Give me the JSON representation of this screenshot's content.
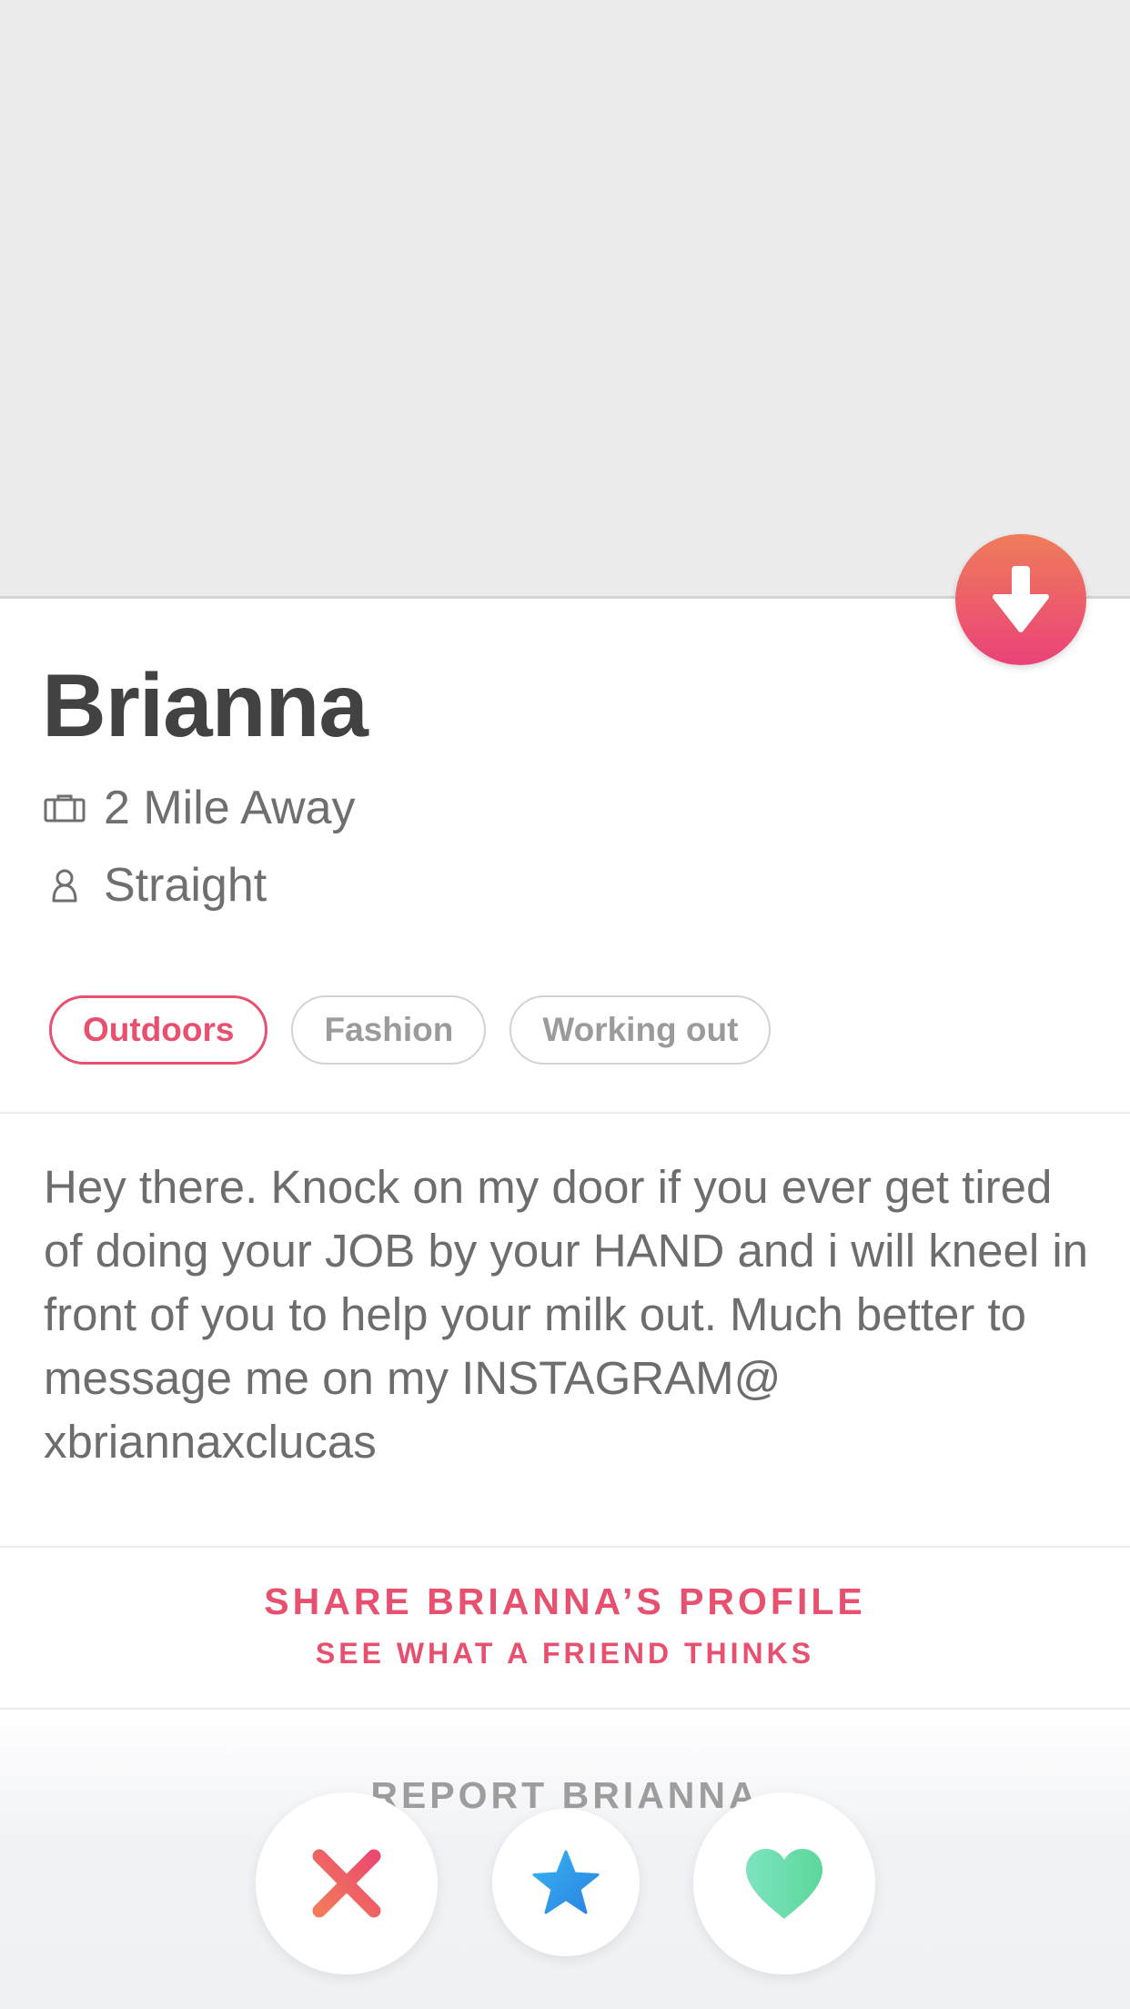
{
  "profile": {
    "name": "Brianna",
    "distance": "2 Mile Away",
    "orientation": "Straight",
    "bio": "Hey there. Knock on my door if you ever get tired of doing your JOB by your HAND and i will kneel in front of you to help your milk out. Much better to message me on my INSTAGRAM@ xbriannaxclucas"
  },
  "interests": [
    {
      "label": "Outdoors",
      "shared": true
    },
    {
      "label": "Fashion",
      "shared": false
    },
    {
      "label": "Working out",
      "shared": false
    }
  ],
  "share": {
    "title": "SHARE BRIANNA’S PROFILE",
    "subtitle": "SEE WHAT A FRIEND THINKS"
  },
  "report": {
    "label": "REPORT BRIANNA"
  },
  "icons": {
    "collapse": "arrow-down-icon",
    "distance": "briefcase-icon",
    "orientation": "person-icon",
    "nope": "x-icon",
    "super_like": "star-icon",
    "like": "heart-icon"
  },
  "colors": {
    "accent": "#e8506f",
    "collapse_gradient_top": "#ef7d5a",
    "collapse_gradient_bottom": "#ea4278",
    "super_like": "#3a9bea",
    "like": "#62dca4"
  }
}
